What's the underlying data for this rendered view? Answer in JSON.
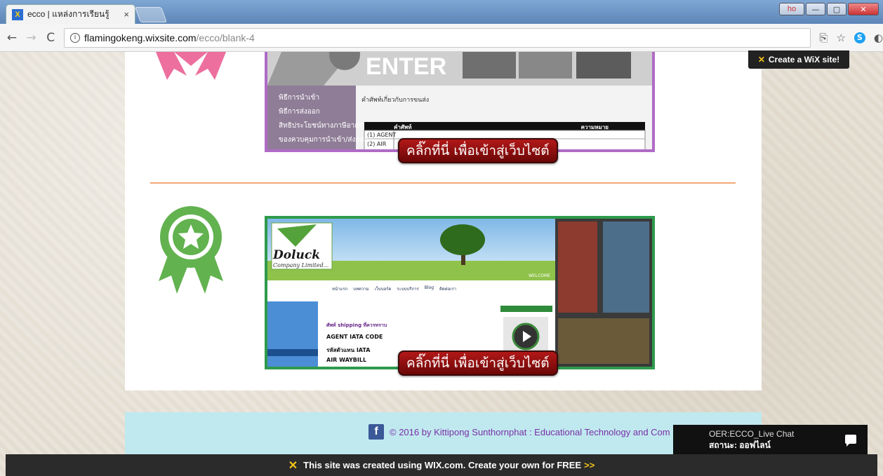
{
  "browser": {
    "tab_title": "ecco | แหล่งการเรียนรู้",
    "tab_close": "×",
    "url_host": "flamingokeng.wixsite.com",
    "url_path": "/ecco/blank-4",
    "profile_label": "ho"
  },
  "wix": {
    "create_site": "Create a WiX site!",
    "banner_text": "This site was created using WIX.com. Create your own for FREE",
    "banner_arrows": ">>"
  },
  "sections": [
    {
      "preview_center_text": "ENTER",
      "preview_heading": "คำศัพท์เกี่ยวกับการขนส่ง",
      "preview_menu": [
        "พิธีการนำเข้า",
        "พิธีการส่งออก",
        "สิทธิประโยชน์ทางภาษีอากร",
        "ของควบคุมการนำเข้า/ส่งออก"
      ],
      "preview_table_header": [
        "คำศัพท์",
        "ความหมาย"
      ],
      "preview_table_rows": [
        "(1) AGENT",
        "(2) AIR"
      ],
      "button_label": "คลิ๊กที่นี่ เพื่อเข้าสู่เว็บไซต์"
    },
    {
      "preview_logo": "Doluck",
      "preview_logo_sub": "Company Limited...",
      "preview_welcome": "WELCOME",
      "preview_nav": [
        "หน้าแรก",
        "บทความ",
        "เว็บบอร์ด",
        "ระบบบริการ",
        "Blog",
        "ติดต่อเรา"
      ],
      "preview_items": [
        "ศัพท์ shipping ที่ควรทราบ",
        "AGENT IATA CODE",
        "รหัสตัวแทน IATA",
        "AIR WAYBILL"
      ],
      "button_label": "คลิ๊กที่นี่ เพื่อเข้าสู่เว็บไซต์"
    }
  ],
  "footer": {
    "fb_letter": "f",
    "text": "© 2016 by Kittipong Sunthornphat : Educational Technology and Com"
  },
  "livechat": {
    "name": "OER:ECCO_Live Chat",
    "status": "สถานะ: ออฟไลน์"
  },
  "colors": {
    "award_pink": "#ec6f9e",
    "award_green": "#62b24f",
    "frame_purple": "#b06bc6",
    "frame_green": "#2e9a4c",
    "divider": "#f2a873",
    "footer_bg": "#bfe9ef"
  }
}
